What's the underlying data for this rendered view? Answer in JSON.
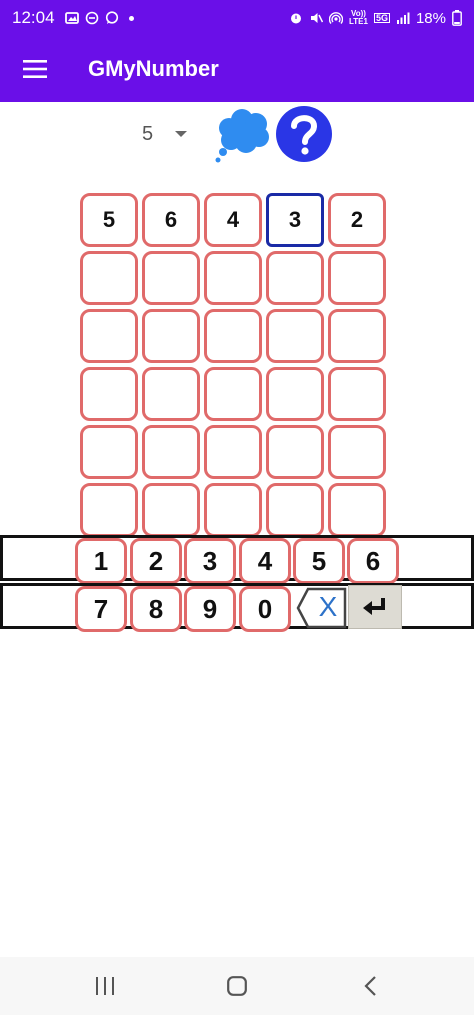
{
  "status_bar": {
    "time": "12:04",
    "volte_label_top": "Vo))",
    "volte_label_bottom": "LTE1",
    "network_label": "5G",
    "battery": "18%"
  },
  "app_bar": {
    "title": "GMyNumber",
    "menu_icon": "hamburger-menu-icon"
  },
  "toolbar": {
    "number_length": "5",
    "hint_icon": "thought-bubble-icon",
    "help_icon": "question-mark-icon",
    "colors": {
      "hint": "#2f8cf0",
      "help": "#2a36e6"
    }
  },
  "grid": {
    "rows": [
      [
        "5",
        "6",
        "4",
        "3",
        "2"
      ],
      [
        "",
        "",
        "",
        "",
        ""
      ],
      [
        "",
        "",
        "",
        "",
        ""
      ],
      [
        "",
        "",
        "",
        "",
        ""
      ],
      [
        "",
        "",
        "",
        "",
        ""
      ],
      [
        "",
        "",
        "",
        "",
        ""
      ]
    ],
    "active_cell": "row 1, column 4",
    "colors": {
      "cell_border": "#e06a6a",
      "active_border": "#1a2aa6"
    }
  },
  "keypad": {
    "row1": [
      "1",
      "2",
      "3",
      "4",
      "5",
      "6"
    ],
    "row2": [
      "7",
      "8",
      "9",
      "0"
    ],
    "backspace_label": "X",
    "backspace_icon": "backspace-icon",
    "enter_icon": "enter-return-icon"
  },
  "nav_bar": {
    "recents_icon": "recent-apps-icon",
    "home_icon": "home-icon",
    "back_icon": "back-chevron-icon"
  },
  "theme": {
    "primary": "#6a0fe8"
  }
}
